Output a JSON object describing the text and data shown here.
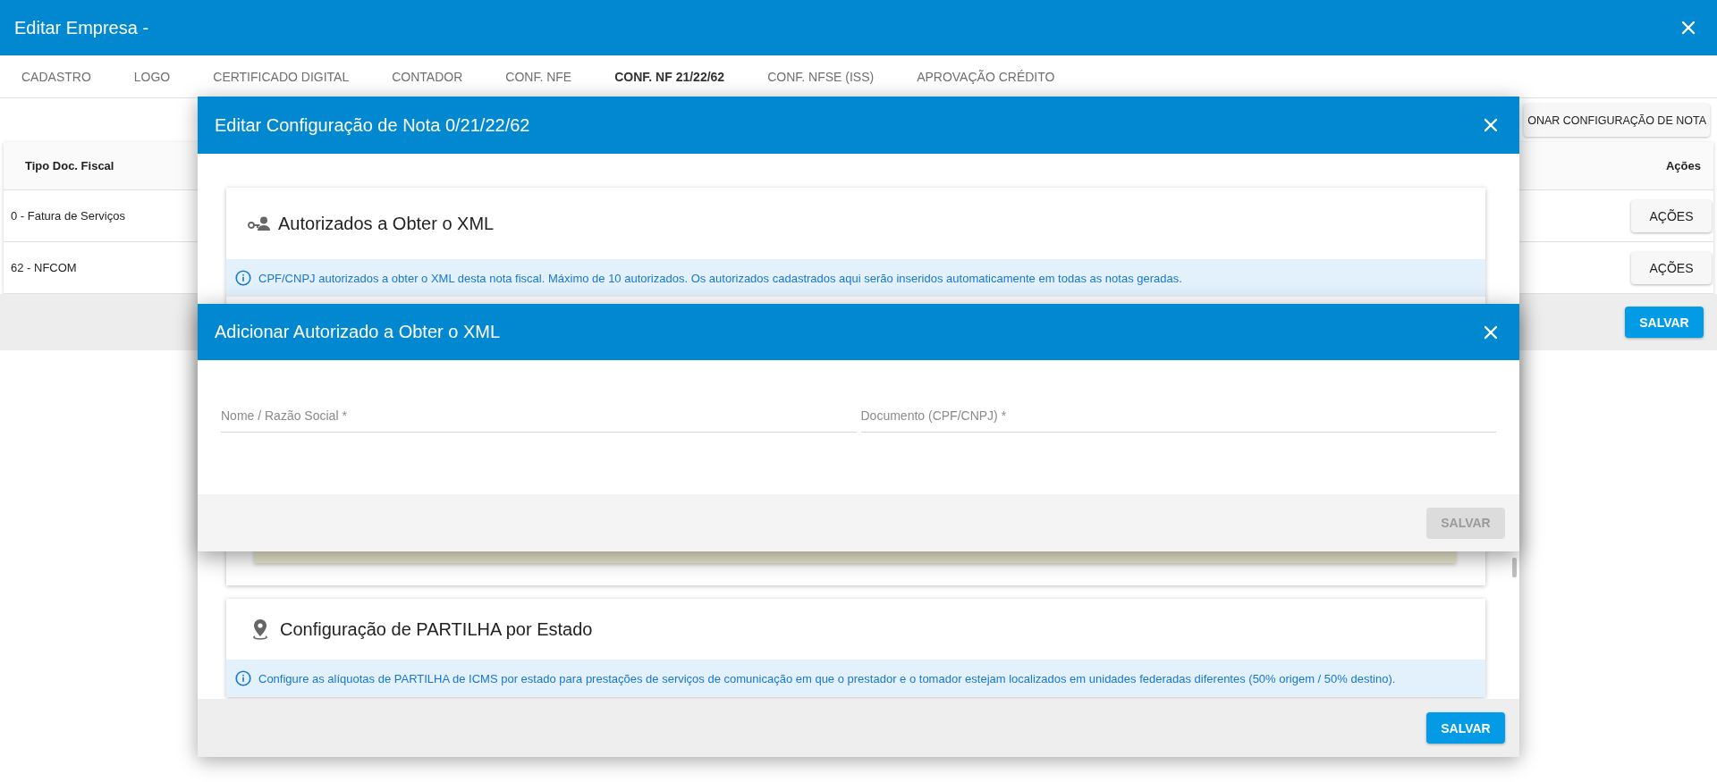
{
  "window": {
    "title": "Editar Empresa -"
  },
  "tabs": [
    {
      "label": "CADASTRO",
      "selected": false
    },
    {
      "label": "LOGO",
      "selected": false
    },
    {
      "label": "CERTIFICADO DIGITAL",
      "selected": false
    },
    {
      "label": "CONTADOR",
      "selected": false
    },
    {
      "label": "CONF. NFE",
      "selected": false
    },
    {
      "label": "CONF. NF 21/22/62",
      "selected": true
    },
    {
      "label": "CONF. NFSE (ISS)",
      "selected": false
    },
    {
      "label": "APROVAÇÃO CRÉDITO",
      "selected": false
    }
  ],
  "toolbar": {
    "add_button": "ONAR CONFIGURAÇÃO DE NOTA"
  },
  "table": {
    "columns": [
      "Tipo Doc. Fiscal",
      "Ações"
    ],
    "rows": [
      {
        "type": "0 - Fatura de Serviços",
        "action": "AÇÕES"
      },
      {
        "type": "62 - NFCOM",
        "action": "AÇÕES"
      }
    ]
  },
  "footer": {
    "save": "SALVAR"
  },
  "config_dialog": {
    "title": "Editar Configuração de Nota 0/21/22/62",
    "sections": [
      {
        "kind": "authorized",
        "title": "Autorizados a Obter o XML",
        "info": "CPF/CNPJ autorizados a obter o XML desta nota fiscal. Máximo de 10 autorizados. Os autorizados cadastrados aqui serão inseridos automaticamente em todas as notas geradas."
      },
      {
        "kind": "sharing",
        "title": "Configuração de PARTILHA por Estado",
        "info": "Configure as alíquotas de PARTILHA de ICMS por estado para prestações de serviços de comunicação em que o prestador e o tomador estejam localizados em unidades federadas diferentes (50% origem / 50% destino)."
      }
    ],
    "save": "SALVAR"
  },
  "add_dialog": {
    "title": "Adicionar Autorizado a Obter o XML",
    "fields": [
      {
        "placeholder": "Nome / Razão Social *"
      },
      {
        "placeholder": "Documento (CPF/CNPJ) *"
      }
    ],
    "save": {
      "label": "SALVAR",
      "disabled": true
    }
  }
}
